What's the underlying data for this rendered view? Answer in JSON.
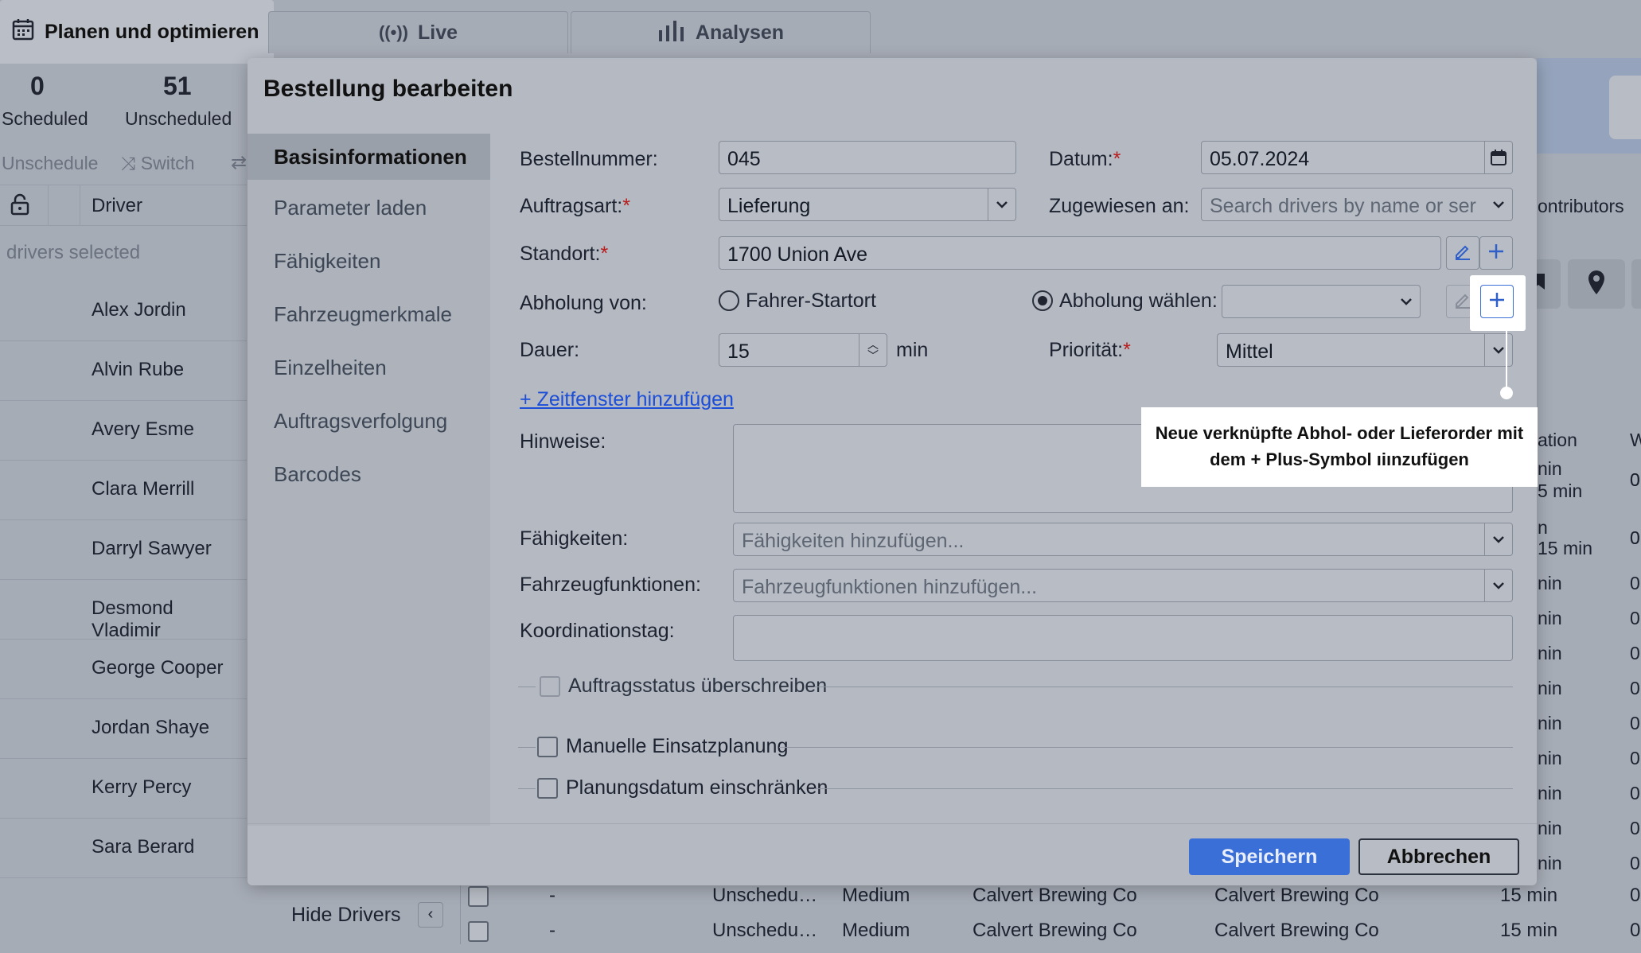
{
  "top_tabs": {
    "active_label": "Planen und optimieren",
    "live_label": "Live",
    "analysen_label": "Analysen"
  },
  "summary": {
    "scheduled_count": "0",
    "scheduled_label": "Scheduled",
    "unscheduled_count": "51",
    "unscheduled_label": "Unscheduled"
  },
  "toolbar": {
    "unschedule_label": "Unschedule",
    "switch_label": "Switch"
  },
  "driver_list": {
    "header": "Driver",
    "selected_text": "drivers selected",
    "drivers": [
      "Alex Jordin",
      "Alvin Rube",
      "Avery Esme",
      "Clara Merrill",
      "Darryl Sawyer",
      "Desmond Vladimir",
      "George Cooper",
      "Jordan Shaye",
      "Kerry Percy",
      "Sara Berard"
    ],
    "hide_drivers_label": "Hide Drivers"
  },
  "right_panel": {
    "contributors_label": "ontributors",
    "column_header_1": "ation",
    "column_header_2": "W",
    "cells": [
      "nin",
      "5 min",
      "n",
      "15 min",
      "nin",
      "nin",
      "nin",
      "nin",
      "nin",
      "nin",
      "nin",
      "nin",
      "nin"
    ],
    "zeros": [
      "0",
      "0",
      "0",
      "0",
      "0",
      "0",
      "0",
      "0",
      "0",
      "0",
      "0",
      "0",
      "0"
    ]
  },
  "bottom_rows": [
    {
      "dash": "-",
      "status": "Unschedu…",
      "priority": "Medium",
      "customer": "Calvert Brewing Co",
      "location": "Calvert Brewing Co",
      "duration": "15 min",
      "extra": "0"
    },
    {
      "dash": "-",
      "status": "Unschedu…",
      "priority": "Medium",
      "customer": "Calvert Brewing Co",
      "location": "Calvert Brewing Co",
      "duration": "15 min",
      "extra": "0"
    }
  ],
  "modal": {
    "title": "Bestellung bearbeiten",
    "nav": [
      "Basisinformationen",
      "Parameter laden",
      "Fähigkeiten",
      "Fahrzeugmerkmale",
      "Einzelheiten",
      "Auftragsverfolgung",
      "Barcodes"
    ],
    "form": {
      "order_number_label": "Bestellnummer:",
      "order_number_value": "045",
      "date_label": "Datum:",
      "date_value": "05.07.2024",
      "order_type_label": "Auftragsart:",
      "order_type_value": "Lieferung",
      "assigned_label": "Zugewiesen an:",
      "assigned_placeholder": "Search drivers by name or ser",
      "location_label": "Standort:",
      "location_value": "1700 Union Ave",
      "pickup_label": "Abholung von:",
      "pickup_option_1": "Fahrer-Startort",
      "pickup_option_2": "Abholung wählen:",
      "duration_label": "Dauer:",
      "duration_value": "15",
      "duration_unit": "min",
      "priority_label": "Priorität:",
      "priority_value": "Mittel",
      "add_time_window": "+ Zeitfenster hinzufügen",
      "notes_label": "Hinweise:",
      "skills_label": "Fähigkeiten:",
      "skills_placeholder": "Fähigkeiten hinzufügen...",
      "vehicle_features_label": "Fahrzeugfunktionen:",
      "vehicle_features_placeholder": "Fahrzeugfunktionen hinzufügen...",
      "coordination_tag_label": "Koordinationstag:",
      "override_status_label": "Auftragsstatus überschreiben",
      "manual_dispatch_label": "Manuelle Einsatzplanung",
      "restrict_date_label": "Planungsdatum einschränken"
    },
    "save_label": "Speichern",
    "cancel_label": "Abbrechen"
  },
  "tooltip": {
    "line1": "Neue verknüpfte Abhol- oder Lieferorder mit",
    "line2": "dem + Plus-Symbol ıiınzufügen"
  },
  "colors": {
    "accent": "#3b6fd8",
    "required": "#b91c1c",
    "link": "#1d4ed8"
  }
}
